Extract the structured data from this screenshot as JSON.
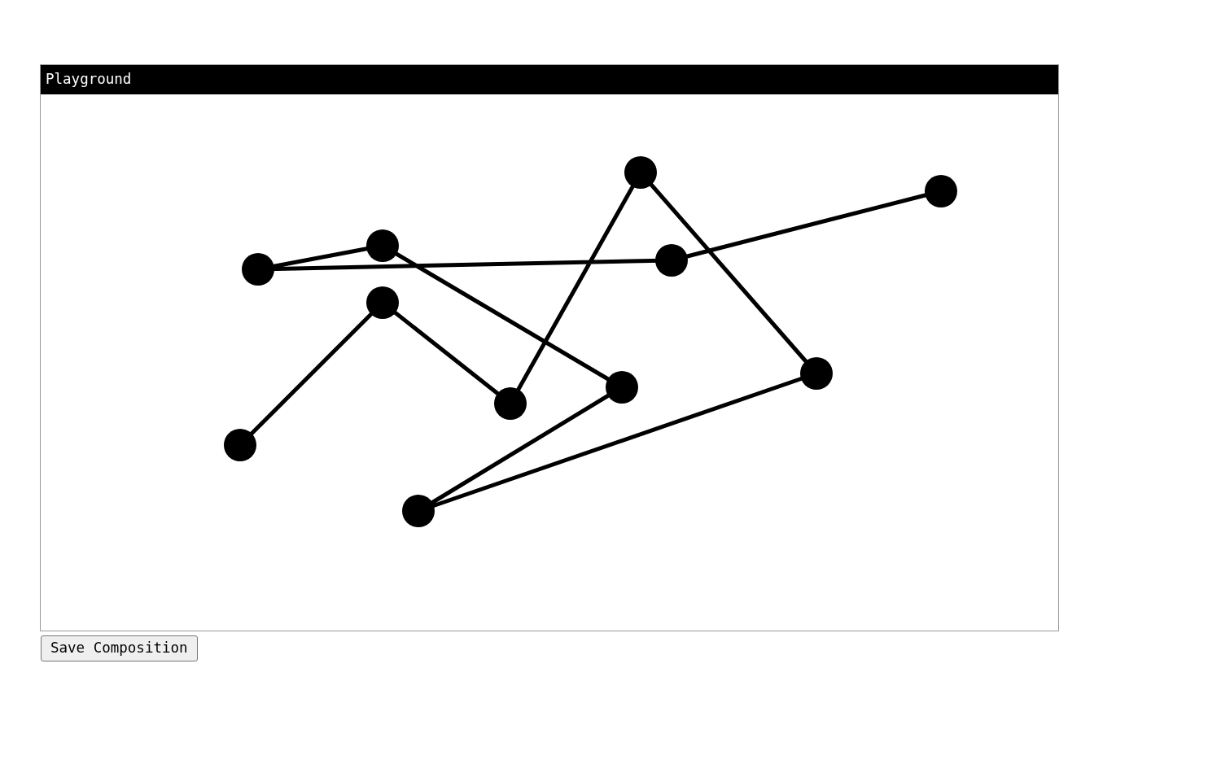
{
  "panel": {
    "title": "Playground"
  },
  "buttons": [
    {
      "label": "Save Composition"
    }
  ]
}
